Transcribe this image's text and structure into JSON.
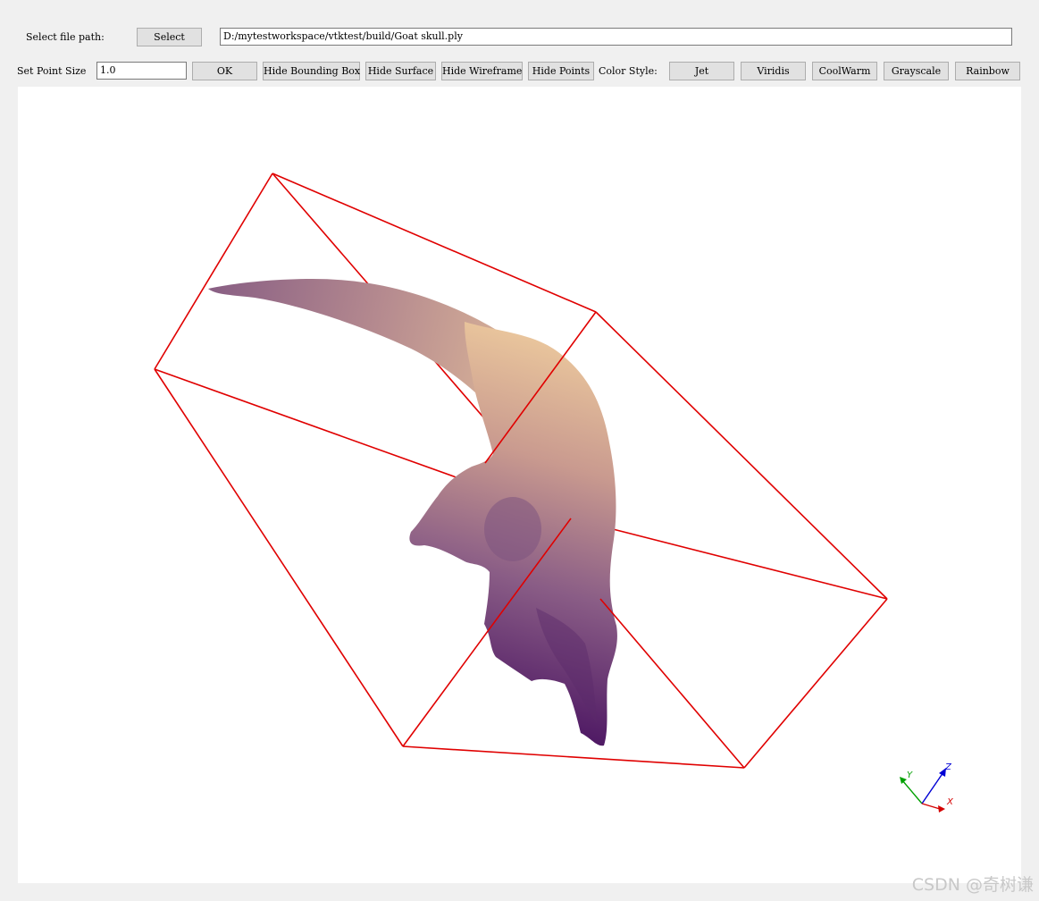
{
  "file_row": {
    "label": "Select file path:",
    "select_button": "Select",
    "path_value": "D:/mytestworkspace/vtktest/build/Goat skull.ply"
  },
  "toolbar": {
    "point_size_label": "Set Point Size",
    "point_size_value": "1.0",
    "ok_button": "OK",
    "hide_bounding_box": "Hide Bounding Box",
    "hide_surface": "Hide Surface",
    "hide_wireframe": "Hide Wireframe",
    "hide_points": "Hide Points",
    "color_style_label": "Color Style:",
    "color_styles": [
      "Jet",
      "Viridis",
      "CoolWarm",
      "Grayscale",
      "Rainbow"
    ]
  },
  "viewport": {
    "bounding_box_color": "#e00000",
    "model_gradient": [
      "#e9c59c",
      "#c99a8f",
      "#8a5d86",
      "#4b1562"
    ],
    "axes": {
      "x_label": "X",
      "y_label": "Y",
      "z_label": "Z",
      "x_color": "#d40000",
      "y_color": "#00a000",
      "z_color": "#0000d4"
    }
  },
  "watermark": "CSDN @奇树谦"
}
